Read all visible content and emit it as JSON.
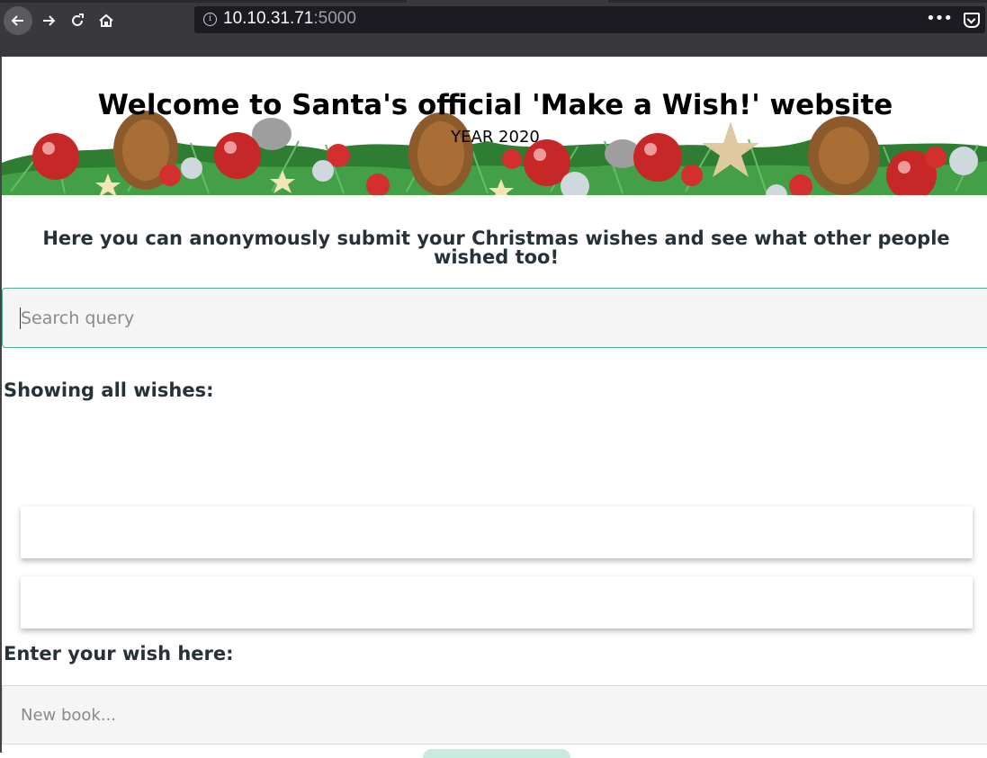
{
  "browser": {
    "url_host": "10.10.31.71",
    "url_port": ":5000",
    "info_symbol": "i",
    "menu_dots": "•••"
  },
  "site": {
    "title": "Welcome to Santa's official 'Make a Wish!' website",
    "year": "YEAR 2020",
    "intro": "Here you can anonymously submit your Christmas wishes and see what other people wished too!"
  },
  "search": {
    "placeholder": "Search query"
  },
  "wishes": {
    "heading": "Showing all wishes:",
    "items": [
      "",
      ""
    ]
  },
  "new_wish": {
    "heading": "Enter your wish here:",
    "placeholder": "New book..."
  },
  "colors": {
    "heading_text": "#263238",
    "search_border": "#4caf95",
    "submit_button": "#c8ebdd"
  }
}
